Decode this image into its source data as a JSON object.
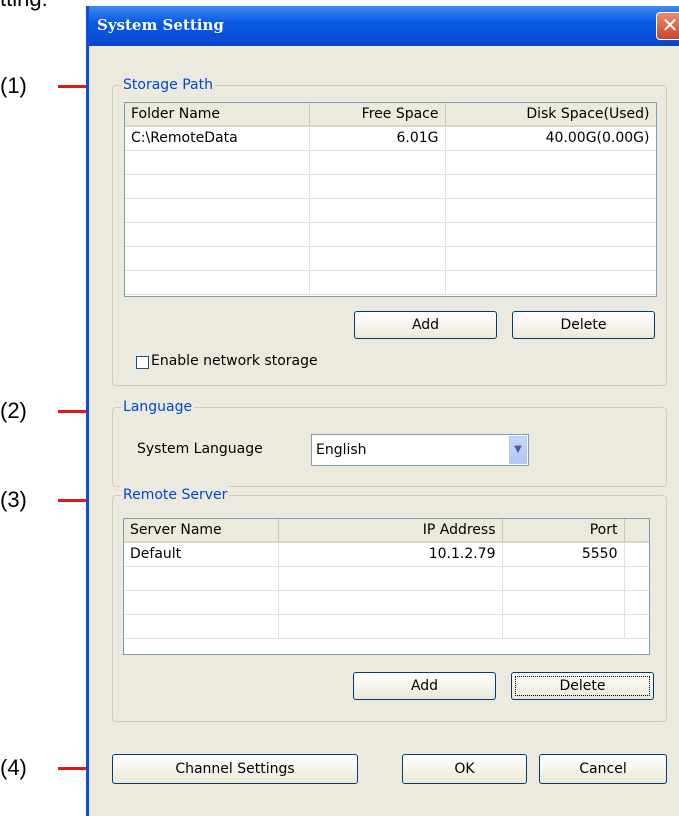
{
  "page_fragment": "tting:",
  "callouts": [
    "(1)",
    "(2)",
    "(3)",
    "(4)"
  ],
  "dialog": {
    "title": "System Setting",
    "close_glyph": "✕"
  },
  "storage": {
    "legend": "Storage Path",
    "columns": [
      "Folder Name",
      "Free Space",
      "Disk Space(Used)"
    ],
    "rows": [
      {
        "folder": "C:\\RemoteData",
        "free": "6.01G",
        "disk": "40.00G(0.00G)"
      }
    ],
    "add_label": "Add",
    "delete_label": "Delete",
    "network_checkbox_label": "Enable network storage",
    "network_checked": false
  },
  "language": {
    "legend": "Language",
    "label": "System Language",
    "selected": "English"
  },
  "remote": {
    "legend": "Remote Server",
    "columns": [
      "Server Name",
      "IP Address",
      "Port"
    ],
    "rows": [
      {
        "name": "Default",
        "ip": "10.1.2.79",
        "port": "5550"
      }
    ],
    "add_label": "Add",
    "delete_label": "Delete"
  },
  "footer": {
    "channel_label": "Channel Settings",
    "ok_label": "OK",
    "cancel_label": "Cancel"
  },
  "colors": {
    "titlebar": "#0a4fd8",
    "legend_text": "#0046d5",
    "callout_line": "#e4141b",
    "dialog_bg": "#eceadf"
  }
}
